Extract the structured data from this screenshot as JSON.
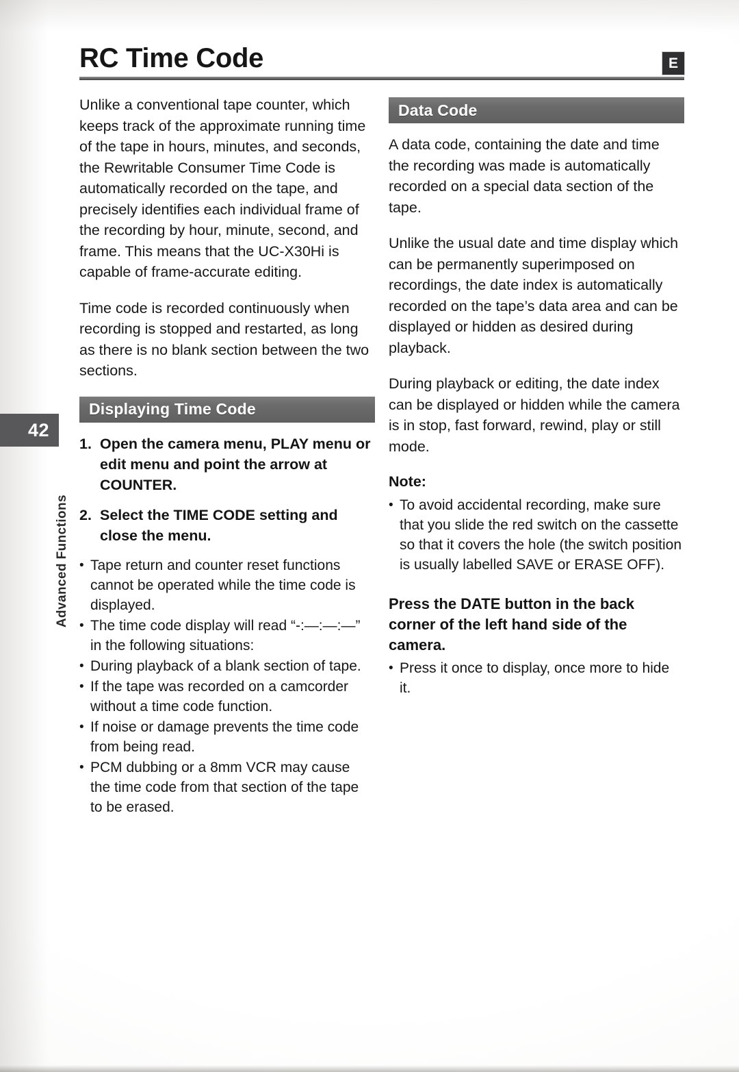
{
  "page": {
    "number": "42",
    "section_label": "Advanced Functions",
    "language_badge": "E",
    "title": "RC Time Code"
  },
  "left_column": {
    "intro_paragraph": "Unlike a conventional tape counter, which keeps track of the approximate running time of the tape in hours, minutes, and seconds, the Rewritable Consumer Time Code is automatically recorded on the tape, and precisely identifies each individual frame of the recording by hour, minute, second, and frame. This means that the UC-X30Hi is capable of frame-accurate editing.",
    "second_paragraph": "Time code is recorded continuously when recording is stopped and restarted, as long as there is no blank section between the two sections.",
    "section_heading": "Displaying Time Code",
    "steps": [
      {
        "num": "1.",
        "text": "Open the camera menu, PLAY menu or edit menu and point the arrow at COUNTER."
      },
      {
        "num": "2.",
        "text": "Select the TIME CODE setting and close the menu."
      }
    ],
    "bullets": [
      "Tape return and counter reset functions cannot be operated while the time code is displayed.",
      "The time code display will read “-:—:—:—” in the following situations:"
    ],
    "sub_bullets": [
      "During playback of a blank section of tape.",
      "If the tape was recorded on a camcorder without a time code function.",
      "If noise or damage prevents the time code from being read.",
      "PCM dubbing or a 8mm VCR may cause the time code from that section of the tape to be erased."
    ]
  },
  "right_column": {
    "section_heading": "Data Code",
    "paragraph_1": "A data code, containing the date and time the recording was made is automatically recorded on a special data section of the tape.",
    "paragraph_2": "Unlike the usual date and time display which can be permanently superimposed on recordings, the date index is automatically recorded on the tape’s data area and can be displayed or hidden as desired during playback.",
    "paragraph_3": "During playback or editing, the date index can be displayed or hidden while the camera is in stop, fast forward, rewind, play or still mode.",
    "note_label": "Note:",
    "note_bullets": [
      "To avoid accidental recording, make sure that you slide the red switch on the cassette so that it covers the hole (the switch position is usually labelled SAVE or ERASE OFF)."
    ],
    "lead_instruction": "Press the DATE button in the back corner of the left hand side of the camera.",
    "lead_bullets": [
      "Press it once to display, once more to hide it."
    ]
  },
  "glyphs": {
    "bullet": "•"
  },
  "colors": {
    "banner_gray": "#6a6a6a",
    "tab_gray": "#58585a",
    "badge_dark": "#2f2f31",
    "text": "#171717"
  }
}
